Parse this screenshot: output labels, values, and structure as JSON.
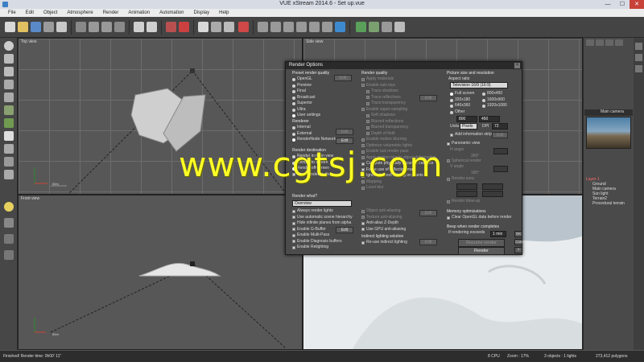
{
  "window": {
    "title": "VUE xStream 2014.6 - Set up.vue",
    "controls": [
      "—",
      "☐",
      "✕"
    ]
  },
  "menu": [
    "File",
    "Edit",
    "Object",
    "Atmosphere",
    "Render",
    "Animation",
    "Automation",
    "Display",
    "Help"
  ],
  "viewports": {
    "top": "Top view",
    "side": "Side view",
    "front": "Front view",
    "scale_top": "50m",
    "scale_front": "50m"
  },
  "right_panel": {
    "camera_header": "Main camera",
    "tree": [
      "Layer 1",
      "Ground",
      "Main camera",
      "Sun light",
      "Terrain2",
      "Procedural terrain"
    ]
  },
  "status": {
    "left": "Finished! Render time: 0h00' 11\"",
    "cpu": "8 CPU",
    "zoom": "Zoom : 17%",
    "objects": "3 objects : 1 lights",
    "polygons": "273,412 polygons"
  },
  "dialog": {
    "title": "Render Options",
    "preset": {
      "header": "Preset render quality",
      "options": [
        "OpenGL",
        "Preview",
        "Final",
        "Broadcast",
        "Superior",
        "Ultra",
        "User settings"
      ],
      "selected": "User settings",
      "edit": "Edit"
    },
    "renderer": {
      "header": "Renderer",
      "options": [
        "Internal",
        "External",
        "RenderNode Network"
      ],
      "selected": "RenderNode Network",
      "edit1": "Edit",
      "edit2": "Edit"
    },
    "destination": {
      "header": "Render destination",
      "options": [
        "Render in main view",
        "Render to screen",
        "Render off-screen",
        "Save render to disk"
      ],
      "selected": "Render off-screen"
    },
    "render_what": {
      "header": "Render what?",
      "value": "Overview"
    },
    "options_left": {
      "items": [
        "Always render lights",
        "Use automatic scene hierarchy",
        "Hide infinite planes from alpha",
        "Enable G-Buffer",
        "Enable Multi-Pass",
        "Enable Diagnosis buffers",
        "Enable Relighting"
      ],
      "edit": "Edit"
    },
    "quality": {
      "header": "Render quality",
      "items": [
        {
          "label": "Apply materials",
          "enabled": false
        },
        {
          "label": "Enable sub-rays",
          "enabled": false
        },
        {
          "label": "Trace shadows",
          "enabled": false
        },
        {
          "label": "Trace reflections",
          "enabled": false
        },
        {
          "label": "Trace transparency",
          "enabled": false
        },
        {
          "label": "Enable super-sampling",
          "enabled": false
        },
        {
          "label": "Soft shadows",
          "enabled": false
        },
        {
          "label": "Blurred reflections",
          "enabled": false
        },
        {
          "label": "Blurred transparency",
          "enabled": false
        },
        {
          "label": "Depth of field",
          "enabled": false
        },
        {
          "label": "Enable motion blurring",
          "enabled": false
        },
        {
          "label": "Optimize volumetric lights",
          "enabled": false
        },
        {
          "label": "Enable last render pass",
          "enabled": false
        },
        {
          "label": "Apply motion blur to object deformation",
          "enabled": false
        },
        {
          "label": "Compute physically accurate caustics",
          "enabled": true
        },
        {
          "label": "Force use of reflection map",
          "enabled": true
        },
        {
          "label": "Ignore indirect lighting on plants",
          "enabled": true
        },
        {
          "label": "Mapping",
          "enabled": false
        },
        {
          "label": "Level blur",
          "enabled": false
        }
      ],
      "edit": "Edit"
    },
    "antialias": {
      "items": [
        {
          "label": "Object anti-aliasing",
          "enabled": false
        },
        {
          "label": "Texture anti-aliasing",
          "enabled": false
        },
        {
          "label": "Anti-alias Z-Depth",
          "enabled": true
        },
        {
          "label": "Use GPU anti-aliasing",
          "enabled": true
        }
      ],
      "edit": "Edit"
    },
    "indirect": {
      "header": "Indirect lighting solution",
      "item": "Re-use indirect lighting",
      "edit": "Edit"
    },
    "picture": {
      "header": "Picture size and resolution",
      "aspect_label": "Aspect ratio",
      "aspect_value": "Television 16/9 (16:9)",
      "sizes": [
        "Full screen",
        "800x450",
        "320x180",
        "1600x900",
        "640x360",
        "1920x1080",
        "Other"
      ],
      "width": "800",
      "height": "450",
      "units_label": "Units",
      "units_value": "Pixels",
      "dpi_label": "DPI",
      "dpi_value": "72",
      "info_strip": "Add information strip",
      "edit": "Edit"
    },
    "panoramic": {
      "header": "Panoramic view",
      "h_label": "H angle",
      "h_value": "360°",
      "spherical": "Spherical render",
      "v_label": "V angle",
      "v_value": "180°"
    },
    "area": {
      "header": "Render area",
      "blowup": "Render blow-up"
    },
    "memory": {
      "header": "Memory optimizations",
      "item": "Clear OpenGL data before render"
    },
    "beep": {
      "header": "Beep when render completes",
      "item": "If rendering exceeds",
      "value": "1 min"
    },
    "resume": "Resume render",
    "render": "Render",
    "side": [
      "OK",
      "Cancel",
      "?"
    ]
  },
  "watermark": "www.cgtsj.com"
}
